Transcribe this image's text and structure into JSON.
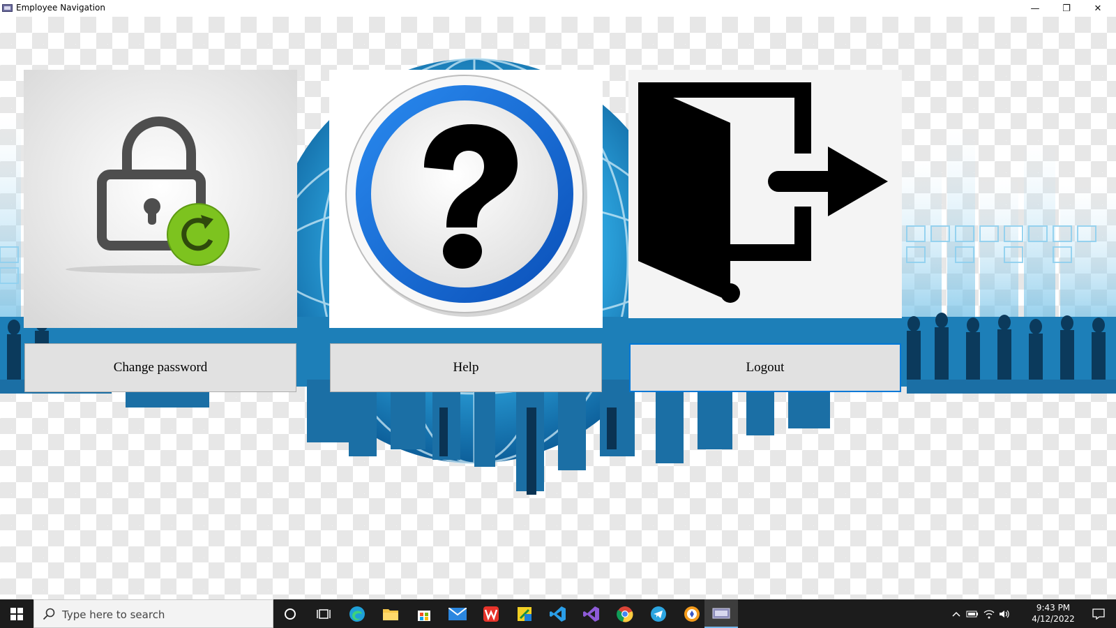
{
  "window": {
    "title": "Employee Navigation",
    "controls": {
      "minimize": "—",
      "restore": "❐",
      "close": "✕"
    }
  },
  "tiles": [
    {
      "id": "change-password",
      "label": "Change password",
      "icon": "lock-refresh-icon",
      "focused": false
    },
    {
      "id": "help",
      "label": "Help",
      "icon": "question-mark-icon",
      "focused": false
    },
    {
      "id": "logout",
      "label": "Logout",
      "icon": "exit-door-icon",
      "focused": true
    }
  ],
  "taskbar": {
    "search_placeholder": "Type here to search",
    "apps": [
      "cortana-icon",
      "task-view-icon",
      "edge-icon",
      "file-explorer-icon",
      "store-icon",
      "mail-icon",
      "wps-icon",
      "sticky-app-icon",
      "vscode-icon",
      "visual-studio-icon",
      "chrome-icon",
      "telegram-icon",
      "vpn-icon",
      "employee-app-icon"
    ],
    "time": "9:43 PM",
    "date": "4/12/2022"
  },
  "colors": {
    "accent": "#0078d7",
    "button_bg": "#e1e1e1",
    "taskbar_bg": "#1c1c1c",
    "lock_green": "#7dc31f",
    "help_blue": "#1170d8"
  }
}
